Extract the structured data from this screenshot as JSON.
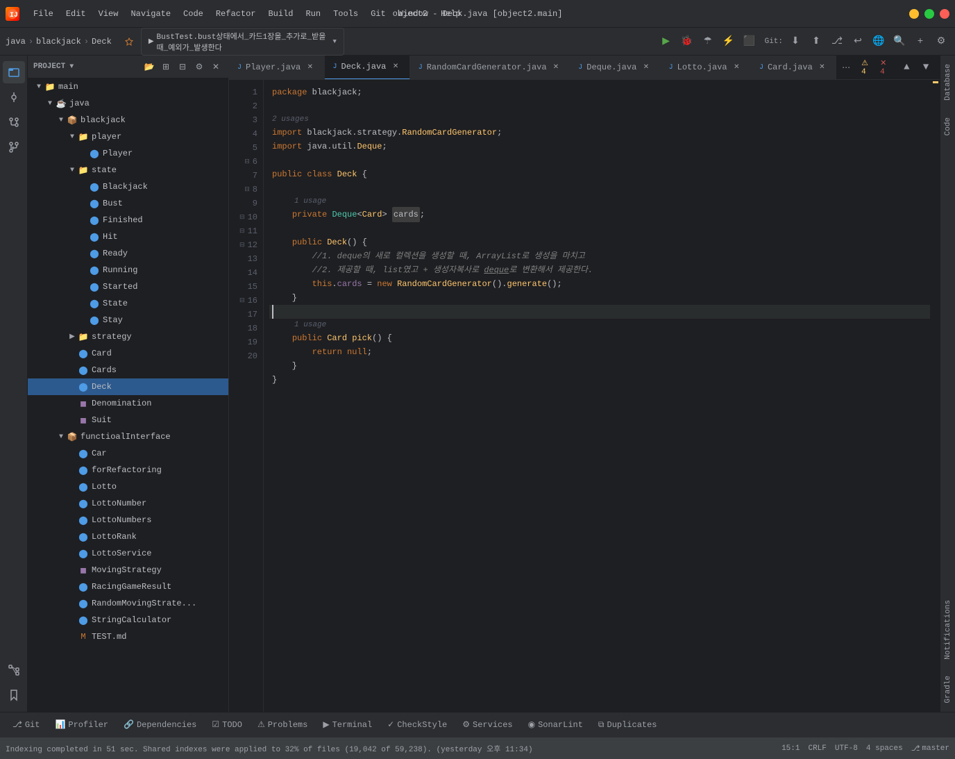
{
  "titlebar": {
    "title": "object2 - Deck.java [object2.main]",
    "appIcon": "🔥",
    "menus": [
      "File",
      "Edit",
      "View",
      "Navigate",
      "Code",
      "Refactor",
      "Build",
      "Run",
      "Tools",
      "Git",
      "Window",
      "Help"
    ]
  },
  "toolbar": {
    "breadcrumb": [
      "java",
      "blackjack",
      "Deck"
    ],
    "runTab": "BustTest.bust상태에서_카드1장을_추가로_받을때_예외가_발생한다",
    "gitLabel": "Git:"
  },
  "tabs": [
    {
      "label": "Player.java",
      "active": false,
      "icon": "J"
    },
    {
      "label": "Deck.java",
      "active": true,
      "icon": "J"
    },
    {
      "label": "RandomCardGenerator.java",
      "active": false,
      "icon": "J"
    },
    {
      "label": "Deque.java",
      "active": false,
      "icon": "J"
    },
    {
      "label": "Lotto.java",
      "active": false,
      "icon": "J"
    },
    {
      "label": "Card.java",
      "active": false,
      "icon": "J"
    }
  ],
  "code": {
    "filename": "Deck.java",
    "lines": [
      {
        "num": 1,
        "content": "package blackjack;",
        "type": "plain"
      },
      {
        "num": 2,
        "content": "",
        "type": "plain"
      },
      {
        "num": 3,
        "content": "import blackjack.strategy.RandomCardGenerator;",
        "type": "import"
      },
      {
        "num": 4,
        "content": "import java.util.Deque;",
        "type": "import"
      },
      {
        "num": 5,
        "content": "",
        "type": "plain"
      },
      {
        "num": 6,
        "content": "public class Deck {",
        "type": "class"
      },
      {
        "num": 7,
        "content": "",
        "type": "plain"
      },
      {
        "num": 8,
        "content": "    private Deque<Card> cards;",
        "type": "field",
        "highlight": "cards"
      },
      {
        "num": 9,
        "content": "",
        "type": "plain"
      },
      {
        "num": 10,
        "content": "    public Deck() {",
        "type": "method"
      },
      {
        "num": 11,
        "content": "        //1. deque의 새로 컬렉션을 생성할 때, ArrayList로 생성을 마치고",
        "type": "comment"
      },
      {
        "num": 12,
        "content": "        //2. 제공할 때, list였고 + 생성자복사로 deque로 변환해서 제공한다.",
        "type": "comment"
      },
      {
        "num": 13,
        "content": "        this.cards = new RandomCardGenerator().generate();",
        "type": "code"
      },
      {
        "num": 14,
        "content": "    }",
        "type": "plain"
      },
      {
        "num": 15,
        "content": "",
        "type": "plain"
      },
      {
        "num": 16,
        "content": "    public Card pick() {",
        "type": "method"
      },
      {
        "num": 17,
        "content": "        return null;",
        "type": "code"
      },
      {
        "num": 18,
        "content": "    }",
        "type": "plain"
      },
      {
        "num": 19,
        "content": "}",
        "type": "plain"
      },
      {
        "num": 20,
        "content": "",
        "type": "plain"
      }
    ]
  },
  "fileTree": {
    "title": "Project",
    "nodes": [
      {
        "label": "main",
        "type": "folder",
        "level": 0,
        "expanded": true
      },
      {
        "label": "java",
        "type": "folder",
        "level": 1,
        "expanded": true
      },
      {
        "label": "blackjack",
        "type": "folder",
        "level": 2,
        "expanded": true
      },
      {
        "label": "player",
        "type": "folder",
        "level": 3,
        "expanded": true
      },
      {
        "label": "Player",
        "type": "java",
        "level": 4
      },
      {
        "label": "state",
        "type": "folder",
        "level": 3,
        "expanded": true
      },
      {
        "label": "Blackjack",
        "type": "java",
        "level": 4
      },
      {
        "label": "Bust",
        "type": "java",
        "level": 4
      },
      {
        "label": "Finished",
        "type": "java",
        "level": 4
      },
      {
        "label": "Hit",
        "type": "java",
        "level": 4
      },
      {
        "label": "Ready",
        "type": "java",
        "level": 4
      },
      {
        "label": "Running",
        "type": "java",
        "level": 4
      },
      {
        "label": "Started",
        "type": "java",
        "level": 4
      },
      {
        "label": "State",
        "type": "java",
        "level": 4
      },
      {
        "label": "Stay",
        "type": "java",
        "level": 4
      },
      {
        "label": "strategy",
        "type": "folder",
        "level": 3,
        "expanded": false
      },
      {
        "label": "Card",
        "type": "java",
        "level": 3
      },
      {
        "label": "Cards",
        "type": "java",
        "level": 3
      },
      {
        "label": "Deck",
        "type": "java",
        "level": 3,
        "selected": true
      },
      {
        "label": "Denomination",
        "type": "java-interface",
        "level": 3
      },
      {
        "label": "Suit",
        "type": "java-interface",
        "level": 3
      },
      {
        "label": "functioalInterface",
        "type": "folder",
        "level": 2,
        "expanded": true
      },
      {
        "label": "Car",
        "type": "java",
        "level": 3
      },
      {
        "label": "forRefactoring",
        "type": "java",
        "level": 3
      },
      {
        "label": "Lotto",
        "type": "java",
        "level": 3
      },
      {
        "label": "LottoNumber",
        "type": "java",
        "level": 3
      },
      {
        "label": "LottoNumbers",
        "type": "java",
        "level": 3
      },
      {
        "label": "LottoRank",
        "type": "java",
        "level": 3
      },
      {
        "label": "LottoService",
        "type": "java",
        "level": 3
      },
      {
        "label": "MovingStrategy",
        "type": "java-interface",
        "level": 3
      },
      {
        "label": "RacingGameResult",
        "type": "java",
        "level": 3
      },
      {
        "label": "RandomMovingStrate...",
        "type": "java",
        "level": 3
      },
      {
        "label": "StringCalculator",
        "type": "java",
        "level": 3
      },
      {
        "label": "TEST.md",
        "type": "md",
        "level": 3
      }
    ]
  },
  "bottomTabs": [
    {
      "label": "Git",
      "icon": "⎇",
      "active": false
    },
    {
      "label": "Profiler",
      "icon": "📊",
      "active": false
    },
    {
      "label": "Dependencies",
      "icon": "🔗",
      "active": false
    },
    {
      "label": "TODO",
      "icon": "☑",
      "active": false
    },
    {
      "label": "Problems",
      "icon": "⚠",
      "active": false
    },
    {
      "label": "Terminal",
      "icon": "▶",
      "active": false
    },
    {
      "label": "CheckStyle",
      "icon": "✓",
      "active": false
    },
    {
      "label": "Services",
      "icon": "⚙",
      "active": false
    },
    {
      "label": "SonarLint",
      "icon": "◉",
      "active": false
    },
    {
      "label": "Duplicates",
      "icon": "⧉",
      "active": false
    }
  ],
  "statusBar": {
    "message": "Indexing completed in 51 sec. Shared indexes were applied to 32% of files (19,042 of 59,238). (yesterday 오후 11:34)",
    "position": "15:1",
    "lineEnding": "CRLF",
    "encoding": "UTF-8",
    "indent": "4 spaces",
    "branch": "master"
  },
  "warnings": {
    "count": "4",
    "errors": "4"
  },
  "rightPanels": [
    "Database",
    "Code",
    "Notifications",
    "Gradle"
  ],
  "leftSideIcons": [
    "project",
    "commit",
    "git",
    "pullRequests"
  ],
  "verticalLabels": [
    "Project",
    "Commit",
    "Pull Requests",
    "Git",
    "Structure",
    "Bookmarks"
  ]
}
